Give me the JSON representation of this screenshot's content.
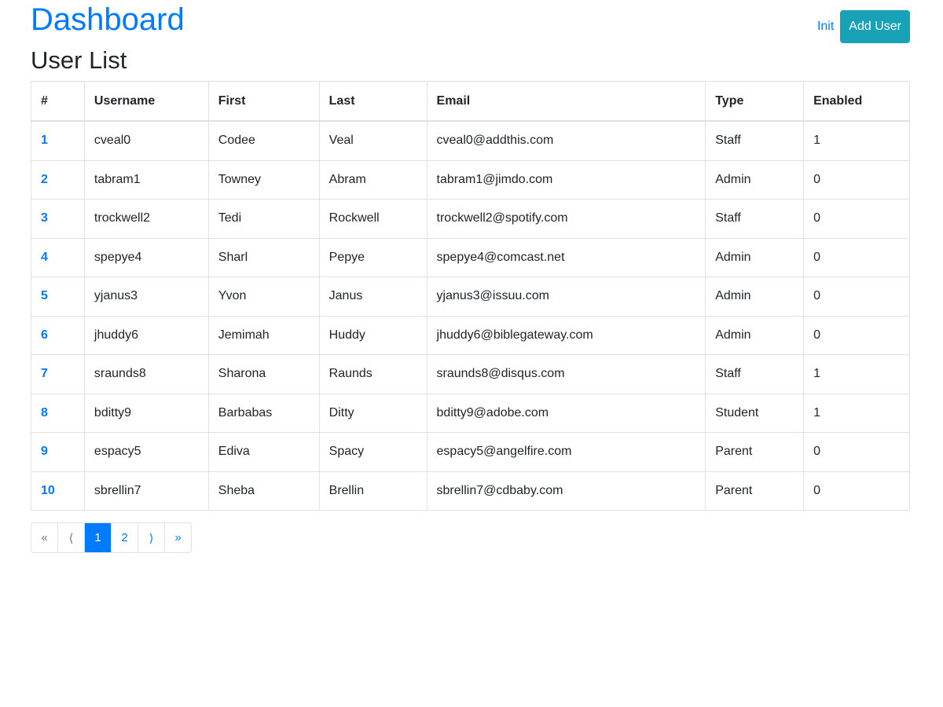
{
  "header": {
    "title": "Dashboard",
    "subtitle": "User List",
    "init_label": "Init",
    "add_user_label": "Add User"
  },
  "table": {
    "columns": [
      "#",
      "Username",
      "First",
      "Last",
      "Email",
      "Type",
      "Enabled"
    ],
    "rows": [
      [
        "1",
        "cveal0",
        "Codee",
        "Veal",
        "cveal0@addthis.com",
        "Staff",
        "1"
      ],
      [
        "2",
        "tabram1",
        "Towney",
        "Abram",
        "tabram1@jimdo.com",
        "Admin",
        "0"
      ],
      [
        "3",
        "trockwell2",
        "Tedi",
        "Rockwell",
        "trockwell2@spotify.com",
        "Staff",
        "0"
      ],
      [
        "4",
        "spepye4",
        "Sharl",
        "Pepye",
        "spepye4@comcast.net",
        "Admin",
        "0"
      ],
      [
        "5",
        "yjanus3",
        "Yvon",
        "Janus",
        "yjanus3@issuu.com",
        "Admin",
        "0"
      ],
      [
        "6",
        "jhuddy6",
        "Jemimah",
        "Huddy",
        "jhuddy6@biblegateway.com",
        "Admin",
        "0"
      ],
      [
        "7",
        "sraunds8",
        "Sharona",
        "Raunds",
        "sraunds8@disqus.com",
        "Staff",
        "1"
      ],
      [
        "8",
        "bditty9",
        "Barbabas",
        "Ditty",
        "bditty9@adobe.com",
        "Student",
        "1"
      ],
      [
        "9",
        "espacy5",
        "Ediva",
        "Spacy",
        "espacy5@angelfire.com",
        "Parent",
        "0"
      ],
      [
        "10",
        "sbrellin7",
        "Sheba",
        "Brellin",
        "sbrellin7@cdbaby.com",
        "Parent",
        "0"
      ]
    ]
  },
  "pagination": {
    "first": "«",
    "prev": "⟨",
    "pages": [
      "1",
      "2"
    ],
    "current": "1",
    "next": "⟩",
    "last": "»"
  },
  "colors": {
    "primary": "#007bff",
    "info": "#17a2b8"
  }
}
